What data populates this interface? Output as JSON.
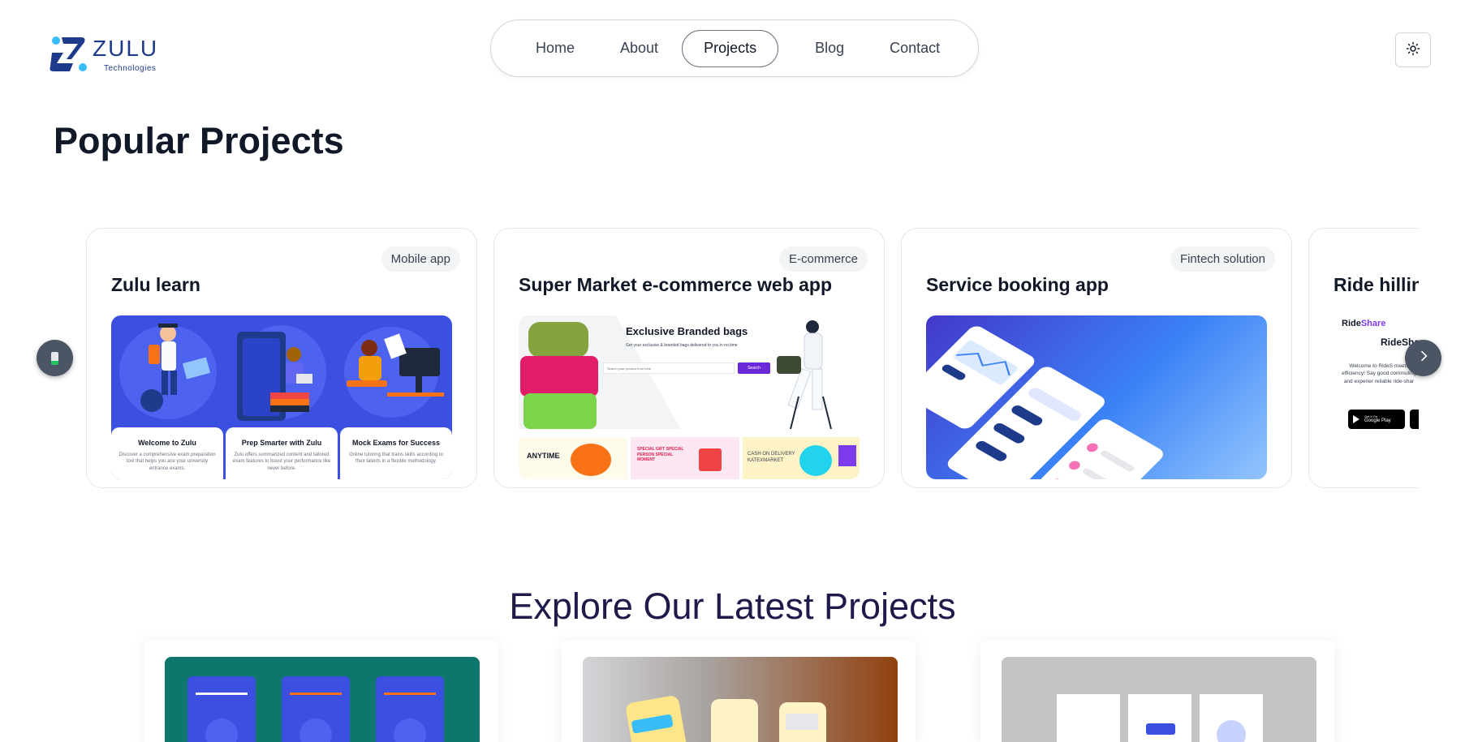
{
  "brand": {
    "name": "ZULU",
    "sub": "Technologies"
  },
  "nav": {
    "items": [
      "Home",
      "About",
      "Projects",
      "Blog",
      "Contact"
    ],
    "active": "Projects"
  },
  "theme_toggle": {
    "icon": "sun-icon"
  },
  "popular": {
    "title": "Popular Projects",
    "cards": [
      {
        "badge": "Mobile app",
        "title": "Zulu learn",
        "panels": [
          {
            "heading": "Welcome to Zulu",
            "text": "Discover a comprehensive exam preparation tool that helps you ace your university entrance exams."
          },
          {
            "heading": "Prep Smarter with Zulu",
            "text": "Zulu offers summarized content and tailored exam features to boost your performance like never before."
          },
          {
            "heading": "Mock Exams for  Success",
            "text": "Online tutoring that trains skills according to their talents in a flexible methodology."
          }
        ]
      },
      {
        "badge": "E-commerce",
        "title": "Super Market e-commerce web app",
        "banner_title": "Exclusive Branded bags",
        "banner_sub": "Get your exclusive & branded bags delivered to you in no time",
        "search_placeholder": "Search your product from here",
        "search_button": "Search",
        "tiles": [
          "ANYTIME",
          "SPECIAL GIFT SPECIAL PERSON SPECIAL MOMENT",
          "CASH ON DELIVERY KATEXMARKET"
        ]
      },
      {
        "badge": "Fintech solution",
        "title": "Service booking app"
      },
      {
        "badge": "",
        "title": "Ride hillin",
        "brand_a": "Ride",
        "brand_b": "Share",
        "welcome": "Welcome to RideS meets efficiency! Say good commuting and experier reliable ride-shar",
        "store_small": "Get it On",
        "store": "Google Play"
      }
    ]
  },
  "latest": {
    "title": "Explore Our Latest Projects"
  },
  "colors": {
    "accent": "#1e3a8a",
    "zulu_blue": "#3b4fe0",
    "ecommerce_purple": "#6d28d9",
    "fintech_blue": "#3b82f6"
  }
}
